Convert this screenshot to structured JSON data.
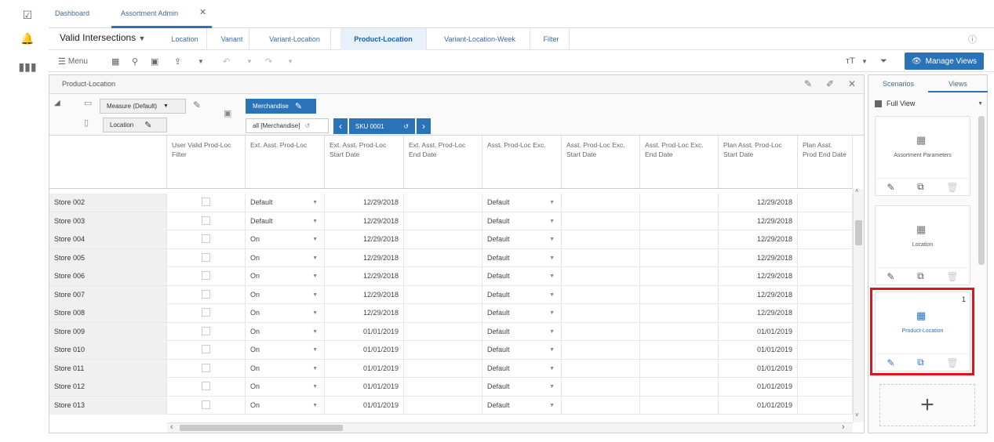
{
  "app_tabs": {
    "dashboard": "Dashboard",
    "assortment_admin": "Assortment Admin"
  },
  "view_tabs": {
    "selector": "Valid Intersections",
    "tabs": [
      "Location",
      "Variant",
      "Variant-Location",
      "Product-Location",
      "Variant-Location-Week",
      "Filter"
    ]
  },
  "toolbar": {
    "menu": "Menu",
    "manage_views": "Manage Views"
  },
  "panel": {
    "title": "Product-Location",
    "measure": "Measure (Default)",
    "location": "Location",
    "merchandise": "Merchandise",
    "all_merch": "all [Merchandise]",
    "sku": "SKU 0001"
  },
  "grid": {
    "headers": [
      "User Valid Prod-Loc Filter",
      "Ext. Asst. Prod-Loc",
      "Ext. Asst. Prod-Loc Start Date",
      "Ext. Asst. Prod-Loc End Date",
      "Asst. Prod-Loc Exc.",
      "Asst. Prod-Loc Exc. Start Date",
      "Asst. Prod-Loc Exc. End Date",
      "Plan Asst. Prod-Loc Start Date",
      "Plan Asst. Prod End Date"
    ],
    "rows": [
      {
        "store": "Store 002",
        "ext": "Default",
        "start": "12/29/2018",
        "exc": "Default",
        "plan": "12/29/2018"
      },
      {
        "store": "Store 003",
        "ext": "Default",
        "start": "12/29/2018",
        "exc": "Default",
        "plan": "12/29/2018"
      },
      {
        "store": "Store 004",
        "ext": "On",
        "start": "12/29/2018",
        "exc": "Default",
        "plan": "12/29/2018"
      },
      {
        "store": "Store 005",
        "ext": "On",
        "start": "12/29/2018",
        "exc": "Default",
        "plan": "12/29/2018"
      },
      {
        "store": "Store 006",
        "ext": "On",
        "start": "12/29/2018",
        "exc": "Default",
        "plan": "12/29/2018"
      },
      {
        "store": "Store 007",
        "ext": "On",
        "start": "12/29/2018",
        "exc": "Default",
        "plan": "12/29/2018"
      },
      {
        "store": "Store 008",
        "ext": "On",
        "start": "12/29/2018",
        "exc": "Default",
        "plan": "12/29/2018"
      },
      {
        "store": "Store 009",
        "ext": "On",
        "start": "01/01/2019",
        "exc": "Default",
        "plan": "01/01/2019"
      },
      {
        "store": "Store 010",
        "ext": "On",
        "start": "01/01/2019",
        "exc": "Default",
        "plan": "01/01/2019"
      },
      {
        "store": "Store 011",
        "ext": "On",
        "start": "01/01/2019",
        "exc": "Default",
        "plan": "01/01/2019"
      },
      {
        "store": "Store 012",
        "ext": "On",
        "start": "01/01/2019",
        "exc": "Default",
        "plan": "01/01/2019"
      },
      {
        "store": "Store 013",
        "ext": "On",
        "start": "01/01/2019",
        "exc": "Default",
        "plan": "01/01/2019"
      }
    ]
  },
  "sidebar": {
    "tabs": [
      "Scenarios",
      "Views"
    ],
    "view_select": "Full View",
    "cards": [
      "Assortment Parameters",
      "Location",
      "Product-Location"
    ],
    "badge": "1"
  }
}
